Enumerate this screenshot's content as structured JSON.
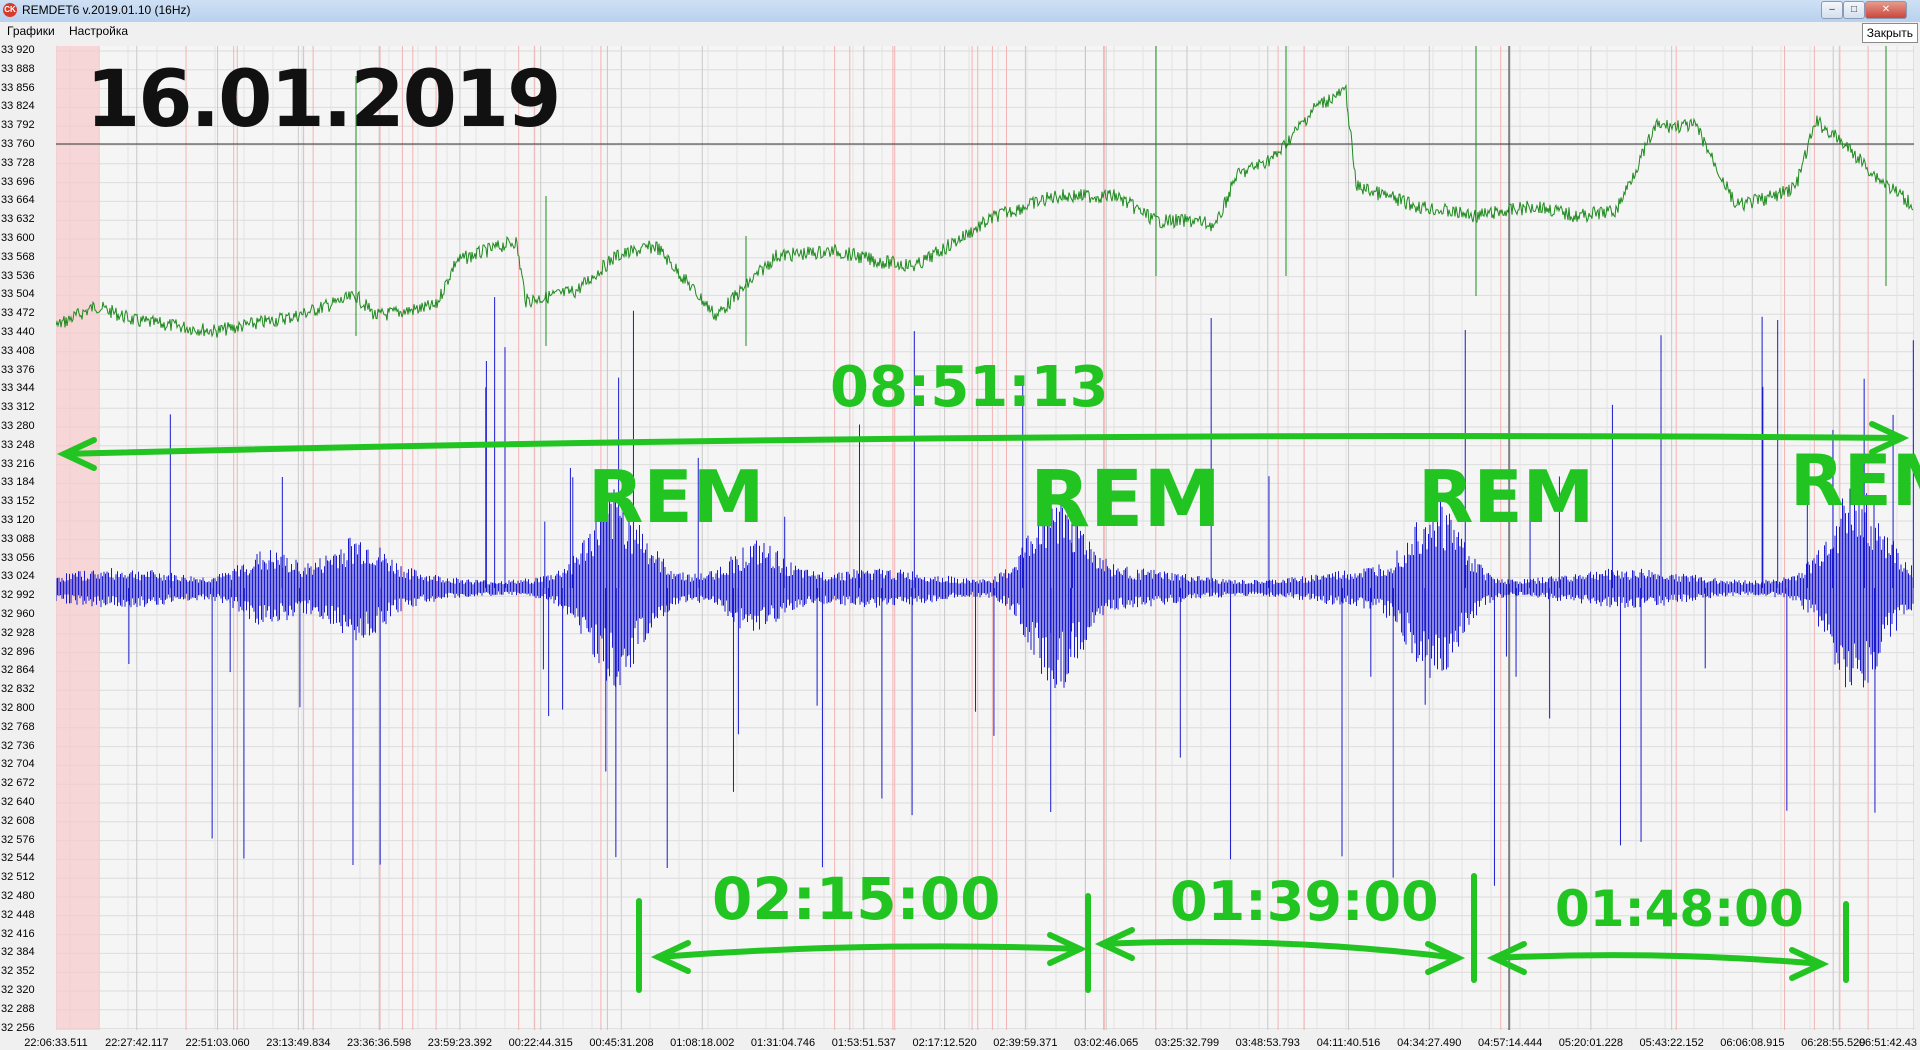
{
  "window": {
    "title": "REMDET6 v.2019.01.10 (16Hz)",
    "app_icon": "CK",
    "minimize_glyph": "–",
    "maximize_glyph": "□",
    "close_glyph": "✕"
  },
  "menu": {
    "items": [
      "Графики",
      "Настройка"
    ],
    "close_label": "Закрыть"
  },
  "y_ticks": [
    "33 920",
    "33 888",
    "33 856",
    "33 824",
    "33 792",
    "33 760",
    "33 728",
    "33 696",
    "33 664",
    "33 632",
    "33 600",
    "33 568",
    "33 536",
    "33 504",
    "33 472",
    "33 440",
    "33 408",
    "33 376",
    "33 344",
    "33 312",
    "33 280",
    "33 248",
    "33 216",
    "33 184",
    "33 152",
    "33 120",
    "33 088",
    "33 056",
    "33 024",
    "32 992",
    "32 960",
    "32 928",
    "32 896",
    "32 864",
    "32 832",
    "32 800",
    "32 768",
    "32 736",
    "32 704",
    "32 672",
    "32 640",
    "32 608",
    "32 576",
    "32 544",
    "32 512",
    "32 480",
    "32 448",
    "32 416",
    "32 384",
    "32 352",
    "32 320",
    "32 288",
    "32 256"
  ],
  "x_ticks": [
    "22:06:33.511",
    "22:27:42.117",
    "22:51:03.060",
    "23:13:49.834",
    "23:36:36.598",
    "23:59:23.392",
    "00:22:44.315",
    "00:45:31.208",
    "01:08:18.002",
    "01:31:04.746",
    "01:53:51.537",
    "02:17:12.520",
    "02:39:59.371",
    "03:02:46.065",
    "03:25:32.799",
    "03:48:53.793",
    "04:11:40.516",
    "04:34:27.490",
    "04:57:14.444",
    "05:20:01.228",
    "05:43:22.152",
    "06:06:08.915",
    "06:28:55.529",
    "06:51:42.43"
  ],
  "annotations": {
    "date": "16.01.2019",
    "total_duration": "08:51:13",
    "rem_label": "REM",
    "cycles": [
      "02:15:00",
      "01:39:00",
      "01:48:00"
    ]
  },
  "colors": {
    "green_trace": "#1f8a1f",
    "blue_trace": "#1a1ad0",
    "annotation_green": "#22c422",
    "red_marker": "#f3b3b3"
  }
}
